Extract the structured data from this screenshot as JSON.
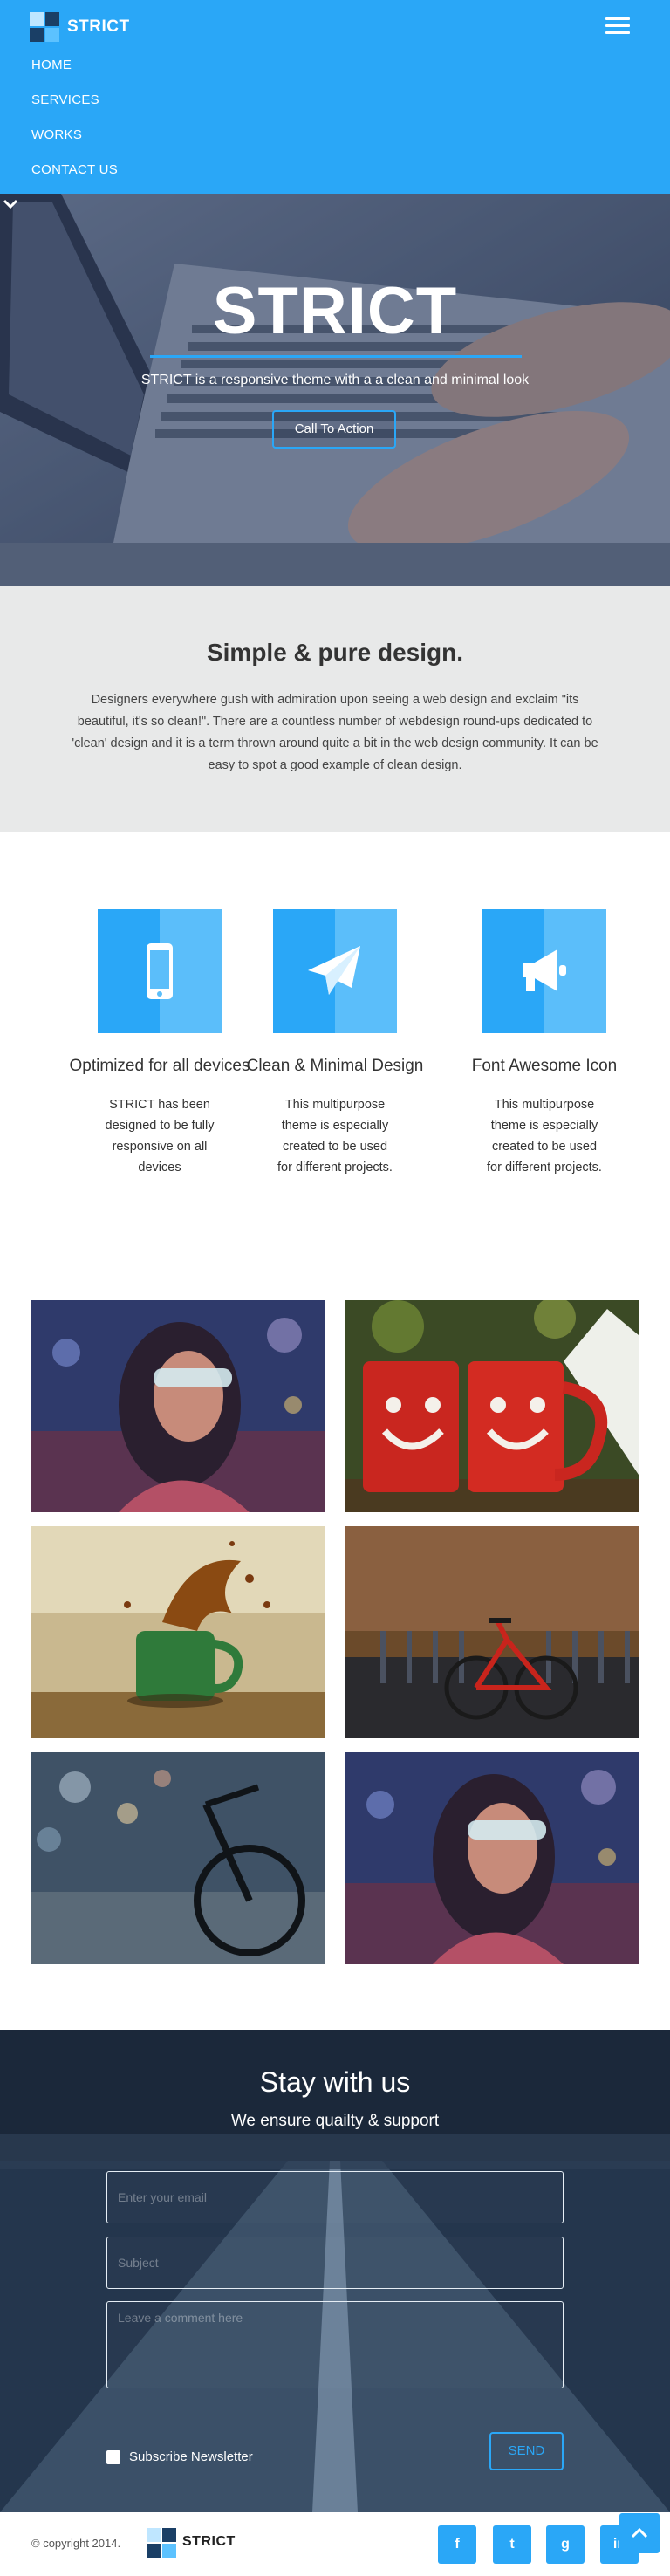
{
  "brand": {
    "name": "STRICT"
  },
  "nav": {
    "menu_icon": "hamburger-icon",
    "items": [
      "HOME",
      "SERVICES",
      "WORKS",
      "CONTACT US"
    ]
  },
  "hero": {
    "title": "STRICT",
    "subtitle": "STRICT is a responsive theme with a a clean and minimal look",
    "cta_label": "Call To Action",
    "scroll_icon": "chevron-down-icon"
  },
  "intro": {
    "title": "Simple & pure design.",
    "text": "Designers everywhere gush with admiration upon seeing a web design and exclaim \"its beautiful, it's so clean!\". There are a countless number of webdesign round-ups dedicated to 'clean' design and it is a term thrown around quite a bit in the web design community. It can be easy to spot a good example of clean design."
  },
  "features": [
    {
      "icon": "mobile-phone-icon",
      "title": "Optimized for all devices",
      "text": "STRICT has been designed to be fully responsive on all devices"
    },
    {
      "icon": "paper-plane-icon",
      "title": "Clean & Minimal Design",
      "text": "This multipurpose theme is especially created to be used for different projects."
    },
    {
      "icon": "bullhorn-icon",
      "title": "Font Awesome Icon",
      "text": "This multipurpose theme is especially created to be used for different projects."
    }
  ],
  "gallery": [
    {
      "subject": "woman with sunglasses"
    },
    {
      "subject": "red smiley mugs"
    },
    {
      "subject": "green cup splash"
    },
    {
      "subject": "red bicycle"
    },
    {
      "subject": "bicycle on street"
    },
    {
      "subject": "woman with sunglasses"
    }
  ],
  "contact": {
    "title": "Stay with us",
    "subtitle": "We ensure quailty & support",
    "email_placeholder": "Enter your email",
    "subject_placeholder": "Subject",
    "comment_placeholder": "Leave a comment here",
    "subscribe_label": "Subscribe Newsletter",
    "send_label": "SEND"
  },
  "footer": {
    "copyright": "© copyright 2014.",
    "social": [
      {
        "icon": "facebook-icon",
        "glyph": "f"
      },
      {
        "icon": "twitter-icon",
        "glyph": "t"
      },
      {
        "icon": "google-plus-icon",
        "glyph": "g"
      },
      {
        "icon": "linkedin-icon",
        "glyph": "in"
      }
    ],
    "back_to_top_icon": "chevron-up-icon"
  },
  "colors": {
    "accent": "#2aa7f7",
    "accent_light": "#5bbefa",
    "intro_bg": "#e8e9e9"
  }
}
